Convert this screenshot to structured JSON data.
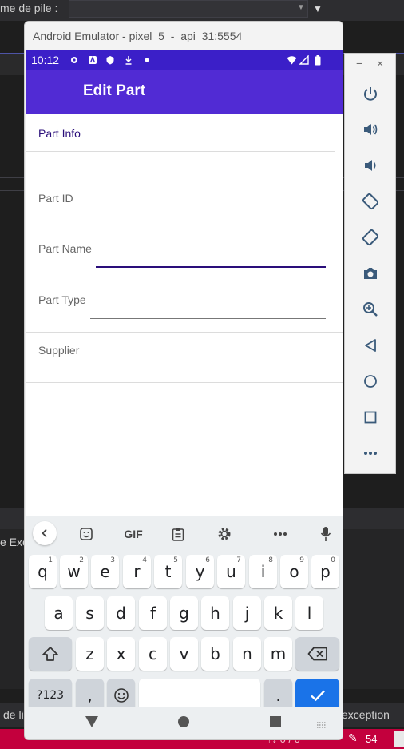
{
  "ide": {
    "top_label": "me de pile :",
    "left_fragment": "e Exé",
    "bottom_left": "de li",
    "bottom_right": "exception",
    "status_selection": "↑↓ 0 / 0",
    "status_count": "54"
  },
  "window": {
    "title": "Android Emulator - pixel_5_-_api_31:5554"
  },
  "statusbar": {
    "time": "10:12"
  },
  "appbar": {
    "title": "Edit Part"
  },
  "form": {
    "section": "Part Info",
    "fields": [
      {
        "label": "Part ID"
      },
      {
        "label": "Part Name"
      },
      {
        "label": "Part Type"
      },
      {
        "label": "Supplier"
      }
    ]
  },
  "keyboard": {
    "gif_label": "GIF",
    "row1": [
      {
        "k": "q",
        "n": "1"
      },
      {
        "k": "w",
        "n": "2"
      },
      {
        "k": "e",
        "n": "3"
      },
      {
        "k": "r",
        "n": "4"
      },
      {
        "k": "t",
        "n": "5"
      },
      {
        "k": "y",
        "n": "6"
      },
      {
        "k": "u",
        "n": "7"
      },
      {
        "k": "i",
        "n": "8"
      },
      {
        "k": "o",
        "n": "9"
      },
      {
        "k": "p",
        "n": "0"
      }
    ],
    "row2": [
      "a",
      "s",
      "d",
      "f",
      "g",
      "h",
      "j",
      "k",
      "l"
    ],
    "row3": [
      "z",
      "x",
      "c",
      "v",
      "b",
      "n",
      "m"
    ],
    "symbols_key": "?123",
    "comma_key": ",",
    "period_key": "."
  },
  "colors": {
    "statusbar": "#3b1fc8",
    "appbar": "#512bd4",
    "accent": "#2a0e7a",
    "enter_key": "#1a73e8"
  }
}
